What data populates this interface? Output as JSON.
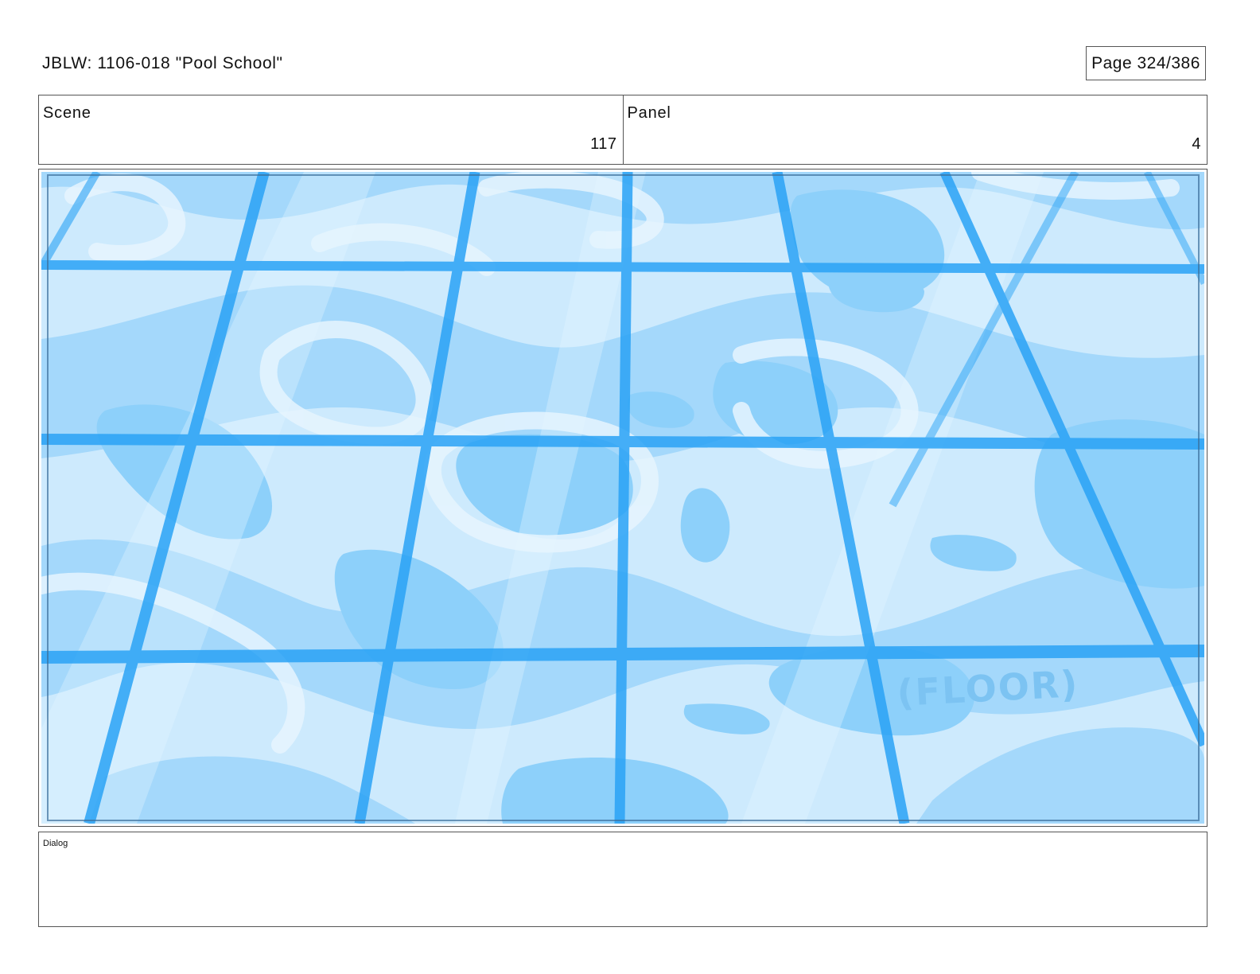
{
  "header": {
    "title": "JBLW: 1106-018 \"Pool School\"",
    "page": "Page 324/386"
  },
  "scene": {
    "label": "Scene",
    "value": "117"
  },
  "panel": {
    "label": "Panel",
    "value": "4"
  },
  "artwork": {
    "annotation": "(FLOOR)"
  },
  "dialog": {
    "label": "Dialog",
    "text": ""
  },
  "colors": {
    "water_light": "#cdeafd",
    "water_mid": "#a4d8fb",
    "water_deep": "#8dd0fa",
    "grout": "#2aa3f6",
    "highlight": "#e6f5fe"
  }
}
